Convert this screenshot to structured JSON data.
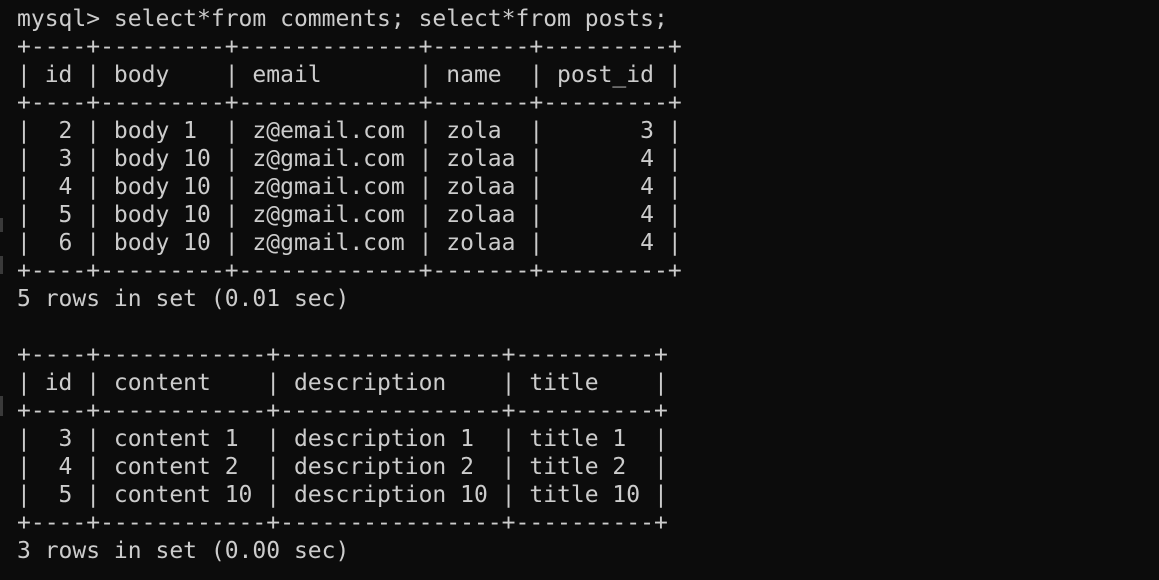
{
  "terminal": {
    "lines": [
      "mysql> select*from comments; select*from posts;",
      "+----+---------+-------------+-------+---------+",
      "| id | body    | email       | name  | post_id |",
      "+----+---------+-------------+-------+---------+",
      "|  2 | body 1  | z@email.com | zola  |       3 |",
      "|  3 | body 10 | z@gmail.com | zolaa |       4 |",
      "|  4 | body 10 | z@gmail.com | zolaa |       4 |",
      "|  5 | body 10 | z@gmail.com | zolaa |       4 |",
      "|  6 | body 10 | z@gmail.com | zolaa |       4 |",
      "+----+---------+-------------+-------+---------+",
      "5 rows in set (0.01 sec)",
      "",
      "+----+------------+----------------+----------+",
      "| id | content    | description    | title    |",
      "+----+------------+----------------+----------+",
      "|  3 | content 1  | description 1  | title 1  |",
      "|  4 | content 2  | description 2  | title 2  |",
      "|  5 | content 10 | description 10 | title 10 |",
      "+----+------------+----------------+----------+",
      "3 rows in set (0.00 sec)"
    ]
  },
  "colors": {
    "background": "#0c0c0c",
    "text": "#cccccc"
  }
}
